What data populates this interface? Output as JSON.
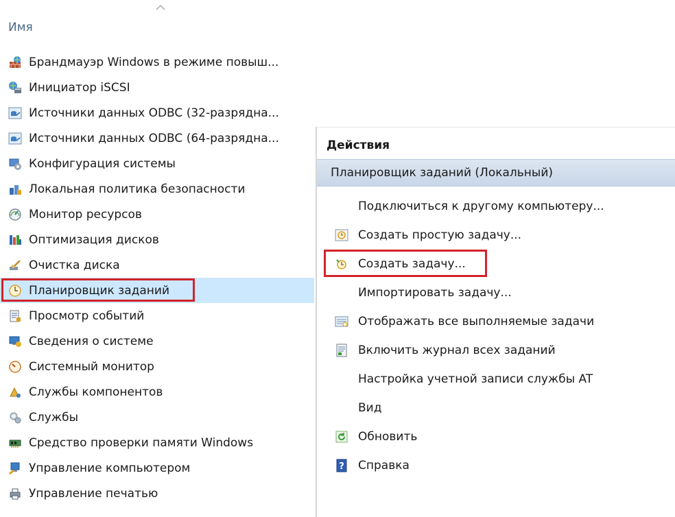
{
  "header": {
    "column_name": "Имя"
  },
  "tools": [
    {
      "label": "Брандмауэр Windows в режиме повыш...",
      "icon": "firewall-icon"
    },
    {
      "label": "Инициатор iSCSI",
      "icon": "iscsi-icon"
    },
    {
      "label": "Источники данных ODBC (32-разрядна...",
      "icon": "odbc-icon"
    },
    {
      "label": "Источники данных ODBC (64-разрядна...",
      "icon": "odbc-icon"
    },
    {
      "label": "Конфигурация системы",
      "icon": "system-config-icon"
    },
    {
      "label": "Локальная политика безопасности",
      "icon": "security-policy-icon"
    },
    {
      "label": "Монитор ресурсов",
      "icon": "resource-monitor-icon"
    },
    {
      "label": "Оптимизация дисков",
      "icon": "defrag-icon"
    },
    {
      "label": "Очистка диска",
      "icon": "disk-cleanup-icon"
    },
    {
      "label": "Планировщик заданий",
      "icon": "task-scheduler-icon",
      "selected": true
    },
    {
      "label": "Просмотр событий",
      "icon": "event-viewer-icon"
    },
    {
      "label": "Сведения о системе",
      "icon": "system-info-icon"
    },
    {
      "label": "Системный монитор",
      "icon": "performance-monitor-icon"
    },
    {
      "label": "Службы компонентов",
      "icon": "component-services-icon"
    },
    {
      "label": "Службы",
      "icon": "services-icon"
    },
    {
      "label": "Средство проверки памяти Windows",
      "icon": "memory-diagnostic-icon"
    },
    {
      "label": "Управление компьютером",
      "icon": "computer-management-icon"
    },
    {
      "label": "Управление печатью",
      "icon": "print-management-icon"
    }
  ],
  "actions_panel": {
    "title": "Действия",
    "section": "Планировщик заданий (Локальный)",
    "items": [
      {
        "label": "Подключиться к другому компьютеру...",
        "icon": ""
      },
      {
        "label": "Создать простую задачу...",
        "icon": "create-basic-task-icon"
      },
      {
        "label": "Создать задачу...",
        "icon": "create-task-icon",
        "highlight": true
      },
      {
        "label": "Импортировать задачу...",
        "icon": ""
      },
      {
        "label": "Отображать все выполняемые задачи",
        "icon": "running-tasks-icon"
      },
      {
        "label": "Включить журнал всех заданий",
        "icon": "history-log-icon"
      },
      {
        "label": "Настройка учетной записи службы AT",
        "icon": ""
      },
      {
        "label": "Вид",
        "icon": ""
      },
      {
        "label": "Обновить",
        "icon": "refresh-icon"
      },
      {
        "label": "Справка",
        "icon": "help-icon"
      }
    ]
  },
  "colors": {
    "selection": "#cce8ff",
    "highlight_border": "#d2232a",
    "header_text": "#4d6b8a",
    "section_bar": "#c8d6e8"
  }
}
